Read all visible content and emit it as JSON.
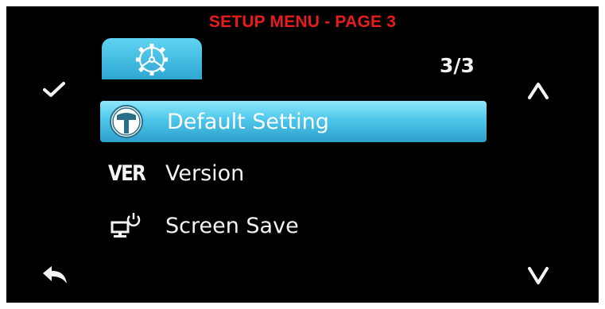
{
  "header": {
    "title": "SETUP MENU - PAGE 3"
  },
  "pagination": {
    "indicator": "3/3"
  },
  "menu": {
    "items": [
      {
        "label": "Default Setting",
        "icon": "hammer-icon",
        "selected": true
      },
      {
        "label": "Version",
        "icon": "ver-icon",
        "icon_text": "VER",
        "selected": false
      },
      {
        "label": "Screen Save",
        "icon": "monitor-power-icon",
        "selected": false
      }
    ]
  },
  "controls": {
    "confirm": "check-icon",
    "back": "back-arrow-icon",
    "up": "chevron-up-icon",
    "down": "chevron-down-icon"
  },
  "colors": {
    "title_red": "#e81c1c",
    "highlight_cyan": "#4ec6ea",
    "background": "#000000",
    "text": "#f4f4f4"
  }
}
